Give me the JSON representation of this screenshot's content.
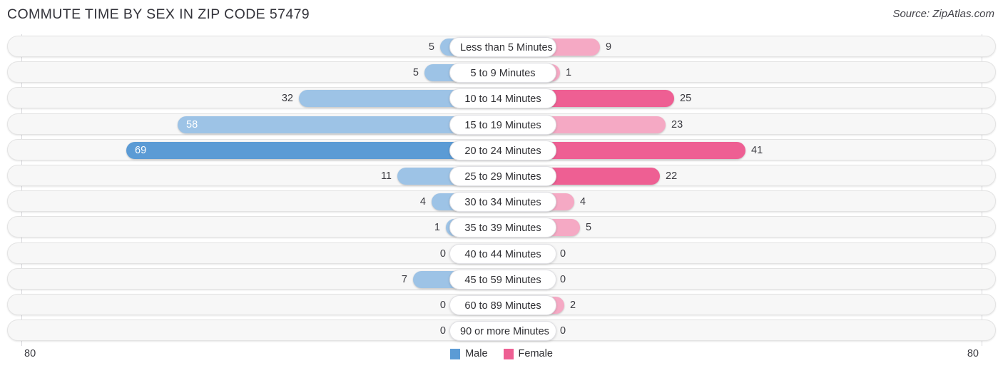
{
  "header": {
    "title": "COMMUTE TIME BY SEX IN ZIP CODE 57479",
    "source": "Source: ZipAtlas.com"
  },
  "legend": {
    "items": [
      {
        "label": "Male",
        "color": "#5b9bd5"
      },
      {
        "label": "Female",
        "color": "#ee5f93"
      }
    ]
  },
  "axis": {
    "left_tick": "80",
    "right_tick": "80"
  },
  "colors": {
    "male_light": "#9dc3e6",
    "male_dark": "#5b9bd5",
    "female_light": "#f5a9c4",
    "female_dark": "#ee5f93",
    "row_background": "#f7f7f7",
    "row_border": "#e3e3e3",
    "axis_line": "#d9d9dd",
    "title": "#33333a"
  },
  "chart_data": {
    "type": "bar",
    "orientation": "horizontal-diverging",
    "title": "COMMUTE TIME BY SEX IN ZIP CODE 57479",
    "xlabel": "",
    "ylabel": "",
    "xlim": [
      -80,
      80
    ],
    "axis_max": 80,
    "grid": false,
    "legend_position": "bottom-center",
    "categories": [
      "Less than 5 Minutes",
      "5 to 9 Minutes",
      "10 to 14 Minutes",
      "15 to 19 Minutes",
      "20 to 24 Minutes",
      "25 to 29 Minutes",
      "30 to 34 Minutes",
      "35 to 39 Minutes",
      "40 to 44 Minutes",
      "45 to 59 Minutes",
      "60 to 89 Minutes",
      "90 or more Minutes"
    ],
    "series": [
      {
        "name": "Male",
        "values": [
          5,
          5,
          32,
          58,
          69,
          11,
          4,
          1,
          0,
          7,
          0,
          0
        ]
      },
      {
        "name": "Female",
        "values": [
          9,
          1,
          25,
          23,
          41,
          22,
          4,
          5,
          0,
          0,
          2,
          0
        ]
      }
    ]
  },
  "rows": [
    {
      "label": "Less than 5 Minutes",
      "male": "5",
      "female": "9",
      "male_w": 88,
      "female_w": 136,
      "male_dark": false,
      "female_dark": false,
      "male_inside": false,
      "female_inside": false
    },
    {
      "label": "5 to 9 Minutes",
      "male": "5",
      "female": "1",
      "male_w": 110,
      "female_w": 80,
      "male_dark": false,
      "female_dark": false,
      "male_inside": false,
      "female_inside": false
    },
    {
      "label": "10 to 14 Minutes",
      "male": "32",
      "female": "25",
      "male_w": 286,
      "female_w": 240,
      "male_dark": false,
      "female_dark": true,
      "male_inside": false,
      "female_inside": false
    },
    {
      "label": "15 to 19 Minutes",
      "male": "58",
      "female": "23",
      "male_w": 456,
      "female_w": 228,
      "male_dark": false,
      "female_dark": false,
      "male_inside": true,
      "female_inside": false
    },
    {
      "label": "20 to 24 Minutes",
      "male": "69",
      "female": "41",
      "male_w": 528,
      "female_w": 340,
      "male_dark": true,
      "female_dark": true,
      "male_inside": true,
      "female_inside": false
    },
    {
      "label": "25 to 29 Minutes",
      "male": "11",
      "female": "22",
      "male_w": 148,
      "female_w": 220,
      "male_dark": false,
      "female_dark": true,
      "male_inside": false,
      "female_inside": false
    },
    {
      "label": "30 to 34 Minutes",
      "male": "4",
      "female": "4",
      "male_w": 100,
      "female_w": 100,
      "male_dark": false,
      "female_dark": false,
      "male_inside": false,
      "female_inside": false
    },
    {
      "label": "35 to 39 Minutes",
      "male": "1",
      "female": "5",
      "male_w": 80,
      "female_w": 108,
      "male_dark": false,
      "female_dark": false,
      "male_inside": false,
      "female_inside": false
    },
    {
      "label": "40 to 44 Minutes",
      "male": "0",
      "female": "0",
      "male_w": 72,
      "female_w": 72,
      "male_dark": false,
      "female_dark": false,
      "male_inside": false,
      "female_inside": false
    },
    {
      "label": "45 to 59 Minutes",
      "male": "7",
      "female": "0",
      "male_w": 126,
      "female_w": 72,
      "male_dark": false,
      "female_dark": false,
      "male_inside": false,
      "female_inside": false
    },
    {
      "label": "60 to 89 Minutes",
      "male": "0",
      "female": "2",
      "male_w": 72,
      "female_w": 86,
      "male_dark": false,
      "female_dark": false,
      "male_inside": false,
      "female_inside": false
    },
    {
      "label": "90 or more Minutes",
      "male": "0",
      "female": "0",
      "male_w": 72,
      "female_w": 72,
      "male_dark": false,
      "female_dark": false,
      "male_inside": false,
      "female_inside": false
    }
  ]
}
